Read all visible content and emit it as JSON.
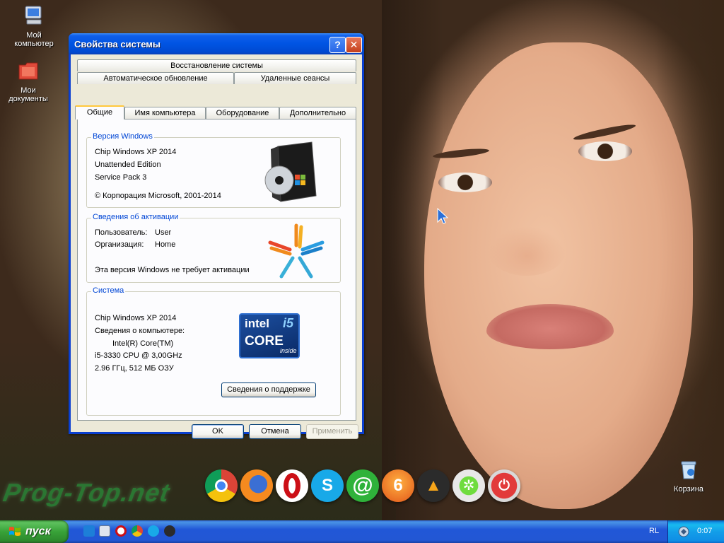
{
  "desktop": {
    "icons": [
      {
        "label_line1": "Мой",
        "label_line2": "компьютер"
      },
      {
        "label_line1": "Мои",
        "label_line2": "документы"
      },
      {
        "label_line1": "Корзина",
        "label_line2": ""
      }
    ],
    "watermark": "Prog-Top.net"
  },
  "window": {
    "title": "Свойства системы",
    "help_glyph": "?",
    "close_glyph": "✕",
    "tabs": {
      "row1": [
        "Восстановление системы"
      ],
      "row2": [
        "Автоматическое обновление",
        "Удаленные сеансы"
      ],
      "row3": [
        "Общие",
        "Имя компьютера",
        "Оборудование",
        "Дополнительно"
      ]
    },
    "windows_version": {
      "title": "Версия Windows",
      "line1": "Chip Windows XP 2014",
      "line2": "Unattended Edition",
      "line3": "Service Pack 3",
      "copyright": "© Корпорация Microsoft, 2001-2014"
    },
    "activation": {
      "title": "Сведения об активации",
      "user_label": "Пользователь:",
      "user_value": "User",
      "org_label": "Организация:",
      "org_value": "Home",
      "note": "Эта версия Windows не требует активации"
    },
    "system": {
      "title": "Система",
      "line1": "Chip Windows XP 2014",
      "line2": "Сведения о компьютере:",
      "line3": "Intel(R) Core(TM)",
      "line4": "i5-3330 CPU @ 3,00GHz",
      "line5": "2.96 ГГц, 512 МБ ОЗУ",
      "badge_brand": "intel",
      "badge_core": "CORE",
      "badge_model": "i5",
      "badge_inside": "inside",
      "support_button": "Сведения о поддержке"
    },
    "buttons": {
      "ok": "OK",
      "cancel": "Отмена",
      "apply": "Применить"
    }
  },
  "dock": [
    "chrome-icon",
    "firefox-icon",
    "opera-icon",
    "skype-icon",
    "mail-agent-icon",
    "burning-icon",
    "aimp-icon",
    "utorrent-icon",
    "shutdown-icon"
  ],
  "taskbar": {
    "start_label": "пуск",
    "language": "RL",
    "clock": "0:07"
  }
}
